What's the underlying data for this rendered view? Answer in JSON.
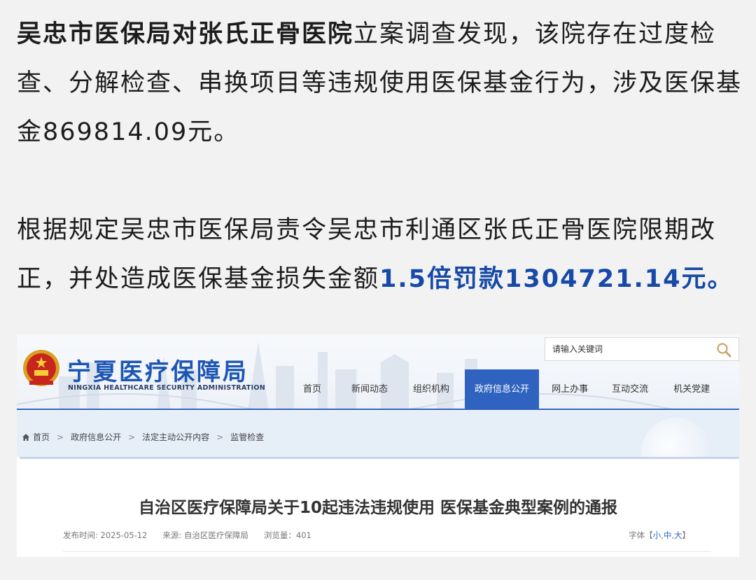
{
  "article": {
    "p1_bold": "吴忠市医保局对张氏正骨医院",
    "p1_rest": "立案调查发现，该院存在过度检查、分解检查、串换项目等违规使用医保基金行为，涉及医保基金869814.09元。",
    "p2_normal": "根据规定吴忠市医保局责令吴忠市利通区张氏正骨医院限期改正，并处造成医保基金损失金额",
    "p2_highlight": "1.5倍罚款1304721.14元。"
  },
  "site": {
    "title": "宁夏医疗保障局",
    "subtitle": "NINGXIA HEALTHCARE SECURITY ADMINISTRATION",
    "search_placeholder": "请输入关键词",
    "nav": [
      "首页",
      "新闻动态",
      "组织机构",
      "政府信息公开",
      "网上办事",
      "互动交流",
      "机关党建"
    ],
    "active_nav": "政府信息公开",
    "breadcrumb": [
      "首页",
      "政府信息公开",
      "法定主动公开内容",
      "监管检查"
    ],
    "doc_title": "自治区医疗保障局关于10起违法违规使用 医保基金典型案例的通报",
    "meta": {
      "date": "发布时间: 2025-05-12",
      "source": "来源: 自治区医疗保障局",
      "views": "浏览量：401"
    },
    "fontsize": {
      "label": "字体【",
      "small": "小",
      "medium": "中",
      "large": "大",
      "close": "】"
    }
  },
  "colors": {
    "accent": "#2f63bf",
    "highlight_text": "#1749a8",
    "title_blue": "#1c56b3"
  },
  "icons": {
    "search": "search-icon",
    "home": "home-icon",
    "emblem": "national-emblem-icon"
  }
}
